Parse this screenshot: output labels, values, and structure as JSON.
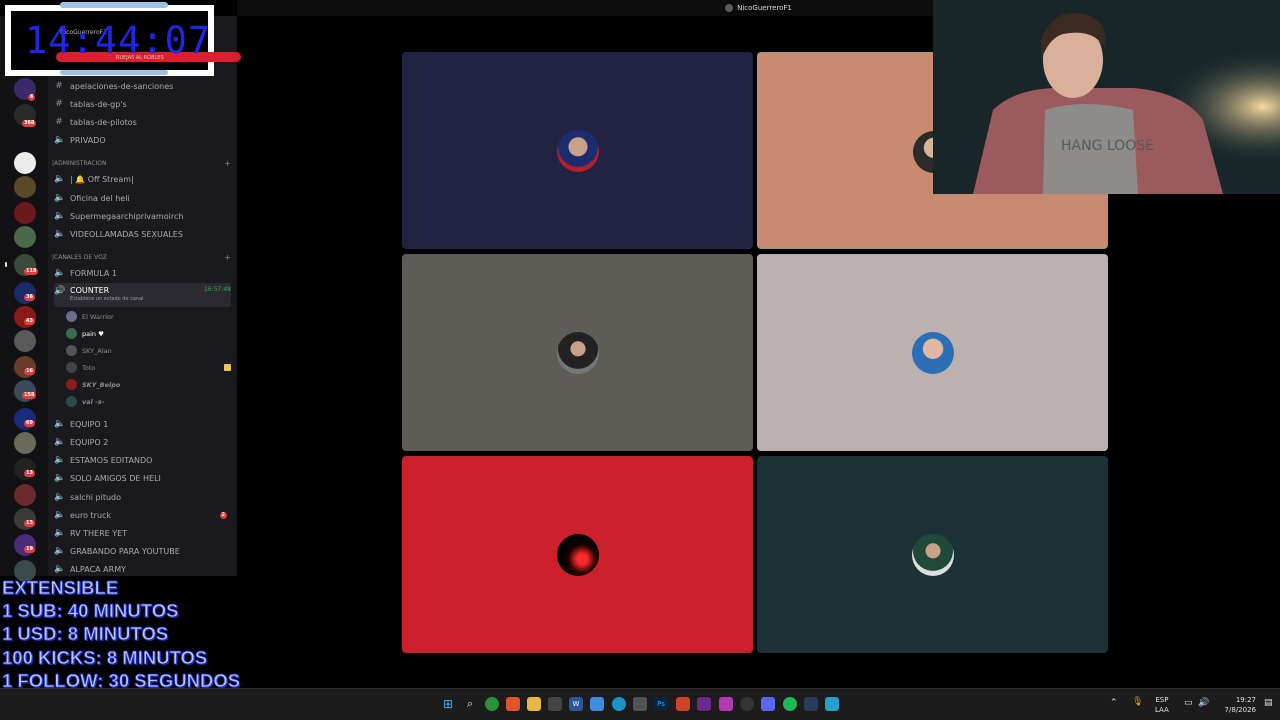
{
  "window": {
    "title": "NicoGuerreroF1"
  },
  "timer": {
    "time": "14:44:07",
    "small_label": "NicoGuerreroF1",
    "strip_text": "RUEJAS AL ROBLES"
  },
  "channels": {
    "text": [
      {
        "label": "apelaciones-de-sanciones",
        "icon": "hash-icon"
      },
      {
        "label": "tablas-de-gp's",
        "icon": "hash-icon"
      },
      {
        "label": "tablas-de-pilotos",
        "icon": "hash-icon"
      },
      {
        "label": "PRIVADO",
        "icon": "speaker-icon"
      }
    ],
    "admin_category": "|ADMINISTRACION",
    "admin": [
      {
        "label": "| 🔔 Off Stream|",
        "icon": "speaker-icon"
      },
      {
        "label": "Oficina del heli",
        "icon": "speaker-icon"
      },
      {
        "label": "Supermegaarchiprivamoirch",
        "icon": "speaker-icon"
      },
      {
        "label": "VIDEOLLAMADAS SEXUALES",
        "icon": "speaker-icon"
      }
    ],
    "voice_category": "|CANALES DE VOZ",
    "voice": [
      {
        "label": "FORMULA 1",
        "icon": "speaker-icon"
      }
    ],
    "active": {
      "label": "COUNTER",
      "status": "Establece un estado de canal",
      "duration": "16:57:48"
    },
    "users": [
      {
        "name": "El Warrior",
        "color": "#6b6b8a"
      },
      {
        "name": "pain ♥",
        "color": "#3a6b4a"
      },
      {
        "name": "SKY_Alan",
        "color": "#555"
      },
      {
        "name": "Toto",
        "color": "#444"
      },
      {
        "name": "SKY_Belpo",
        "color": "#8a1d1d"
      },
      {
        "name": "val -s-",
        "color": "#2a4a4a"
      }
    ],
    "more": [
      {
        "label": "EQUIPO 1"
      },
      {
        "label": "EQUIPO 2"
      },
      {
        "label": "ESTAMOS EDITANDO"
      },
      {
        "label": "SOLO AMIGOS DE HELI"
      },
      {
        "label": "salchi pitudo"
      },
      {
        "label": "euro truck",
        "badge": "2"
      },
      {
        "label": "RV THERE YET"
      },
      {
        "label": "GRABANDO PARA YOUTUBE"
      },
      {
        "label": "ALPACA ARMY"
      }
    ]
  },
  "servers": {
    "badges": [
      "6",
      "368",
      "118",
      "36",
      "43",
      "16",
      "158",
      "69",
      "13",
      "13",
      "19"
    ]
  },
  "video_tiles": [
    {
      "name": "tile-1",
      "bg": "#222241"
    },
    {
      "name": "tile-2",
      "bg": "#c88a71"
    },
    {
      "name": "tile-3",
      "bg": "#5e5c56"
    },
    {
      "name": "tile-4",
      "bg": "#bdb0b1"
    },
    {
      "name": "tile-5",
      "bg": "#cc202d"
    },
    {
      "name": "tile-6",
      "bg": "#1d3237"
    }
  ],
  "overlay": {
    "lines": [
      "EXTENSIBLE",
      "1 SUB: 40 MINUTOS",
      "1 USD: 8 MINUTOS",
      "100 KICKS: 8 MINUTOS",
      "1 FOLLOW: 30 SEGUNDOS"
    ]
  },
  "taskbar": {
    "lang_top": "ESP",
    "lang_bottom": "LAA",
    "time": "19:27",
    "date": "7/8/2026"
  },
  "colors": {
    "accent": "#1f27e6",
    "discord_bg": "#1a1a1e",
    "red": "#d9202f"
  }
}
